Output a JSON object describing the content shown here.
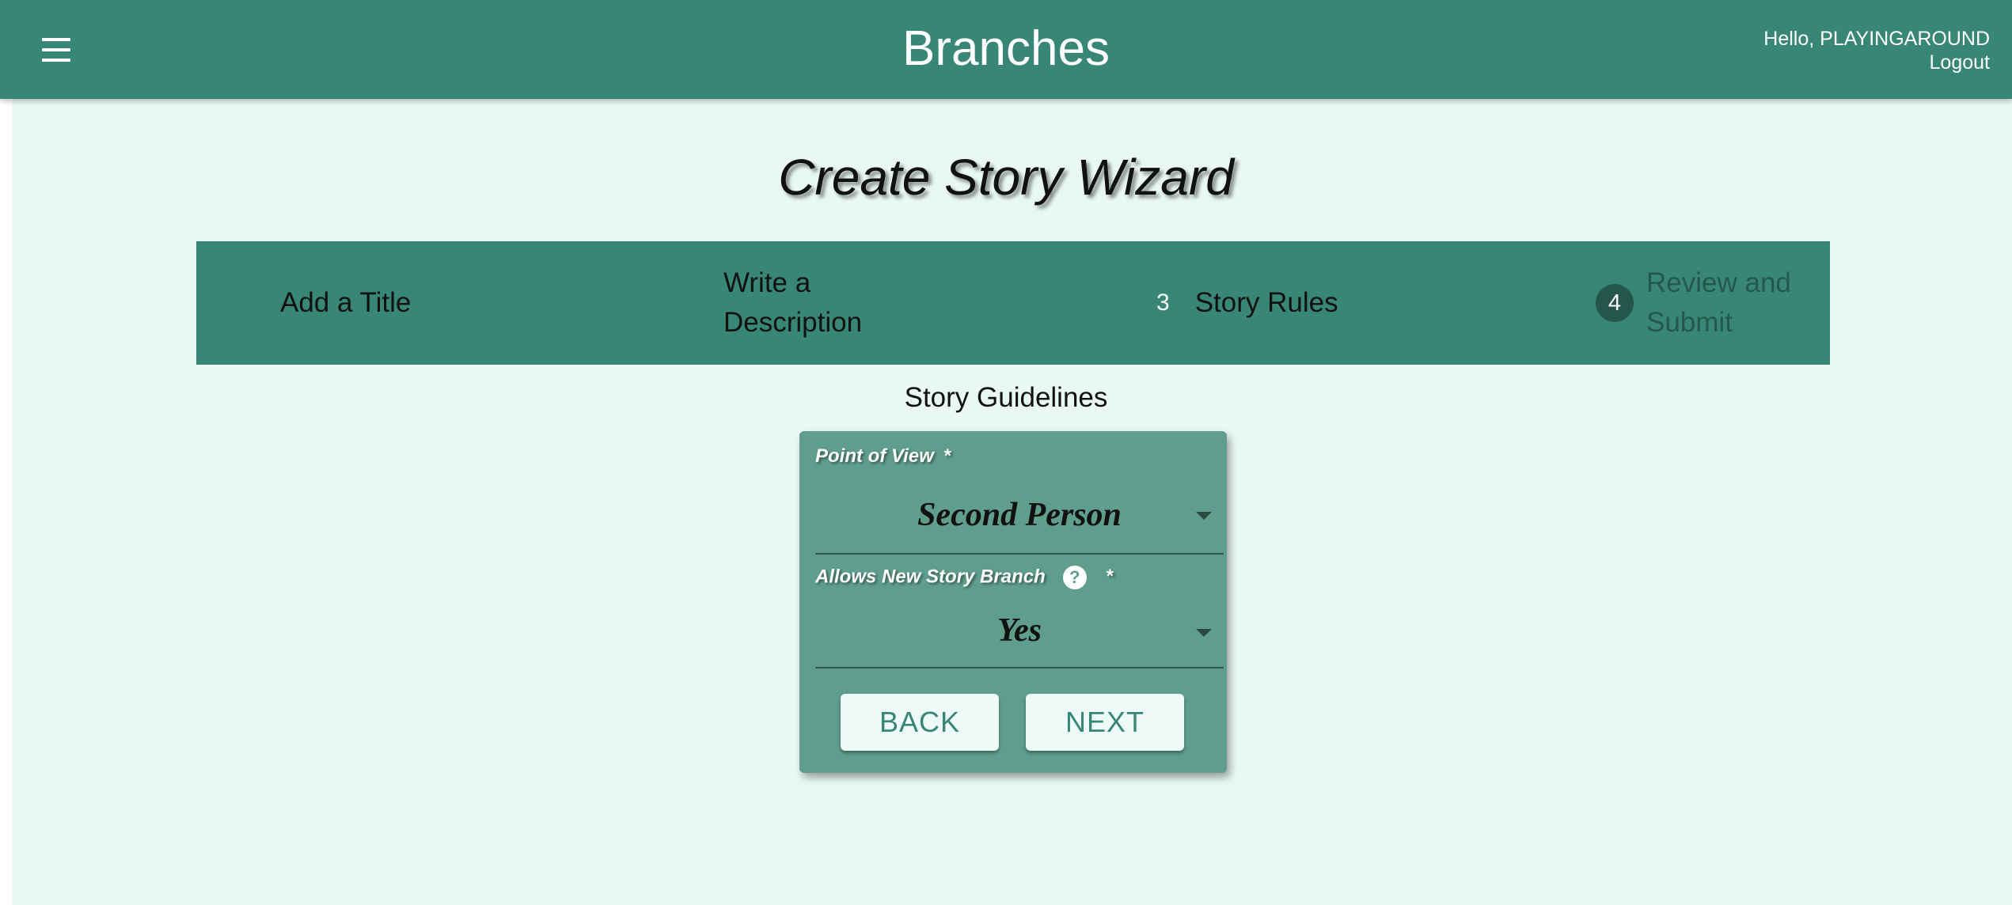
{
  "header": {
    "app_title": "Branches",
    "greeting": "Hello, PLAYINGAROUND",
    "logout_label": "Logout",
    "menu_icon": "hamburger-menu-icon"
  },
  "wizard": {
    "title": "Create Story Wizard",
    "steps": [
      {
        "label": "Add a Title",
        "number": "",
        "state": "completed"
      },
      {
        "label": "Write a Description",
        "number": "",
        "state": "completed"
      },
      {
        "label": "Story Rules",
        "number": "3",
        "state": "active"
      },
      {
        "label": "Review and Submit",
        "number": "4",
        "state": "inactive"
      }
    ]
  },
  "guidelines": {
    "heading": "Story Guidelines",
    "point_of_view": {
      "label": "Point of View",
      "required_mark": "*",
      "value": "Second Person"
    },
    "allows_branch": {
      "label": "Allows New Story Branch",
      "help_glyph": "?",
      "help_icon": "help-circle-icon",
      "required_mark": "*",
      "value": "Yes"
    },
    "back_label": "BACK",
    "next_label": "NEXT"
  },
  "colors": {
    "header_bg": "#388776",
    "page_bg": "#e9f8f4",
    "card_bg": "#5f9e8d",
    "step_circle": "#26564b",
    "button_text": "#388776"
  }
}
